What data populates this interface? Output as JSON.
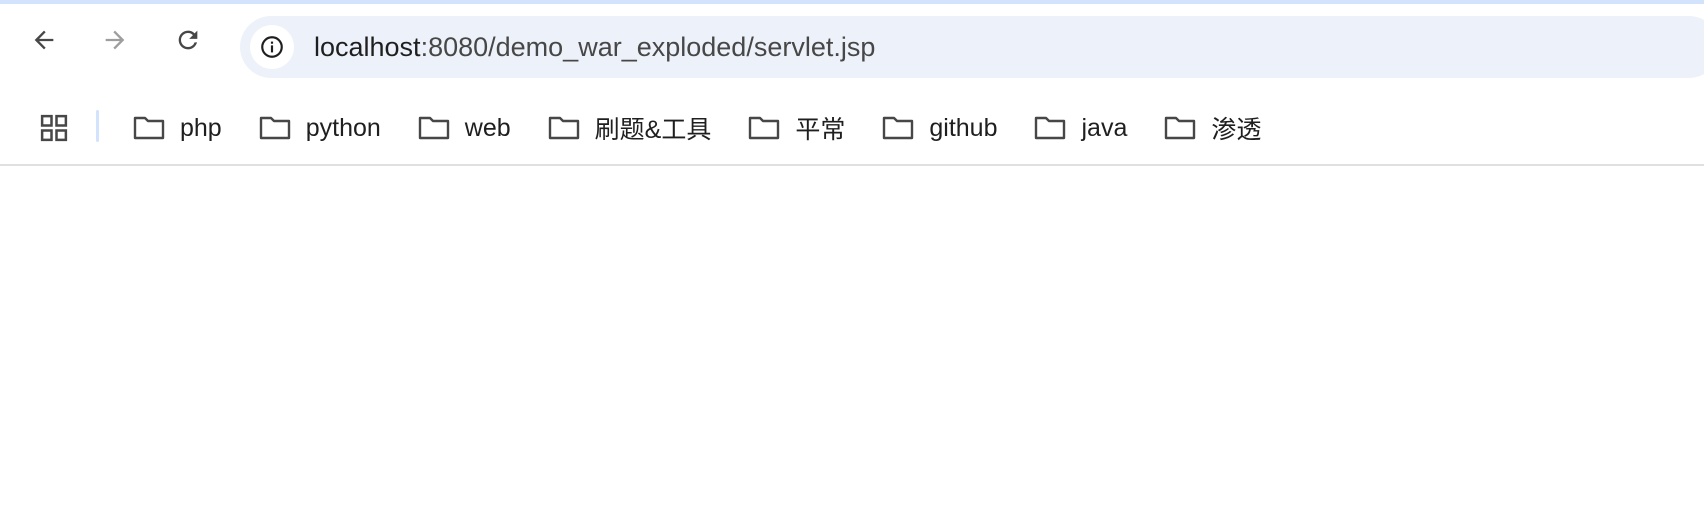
{
  "toolbar": {
    "back_icon": "arrow-left-icon",
    "forward_icon": "arrow-right-icon",
    "reload_icon": "reload-icon",
    "forward_enabled": false
  },
  "omnibox": {
    "site_info_icon": "info-icon",
    "url_host": "localhost",
    "url_rest": ":8080/demo_war_exploded/servlet.jsp"
  },
  "bookmarks": {
    "apps_icon": "apps-grid-icon",
    "items": [
      {
        "label": "php",
        "icon": "folder-icon"
      },
      {
        "label": "python",
        "icon": "folder-icon"
      },
      {
        "label": "web",
        "icon": "folder-icon"
      },
      {
        "label": "刷题&工具",
        "icon": "folder-icon"
      },
      {
        "label": "平常",
        "icon": "folder-icon"
      },
      {
        "label": "github",
        "icon": "folder-icon"
      },
      {
        "label": "java",
        "icon": "folder-icon"
      },
      {
        "label": "渗透",
        "icon": "folder-icon"
      }
    ]
  },
  "colors": {
    "accent_strip": "#d3e3fd",
    "omnibox_bg": "#edf2fa",
    "icon": "#474747",
    "icon_disabled": "#9e9e9e"
  }
}
